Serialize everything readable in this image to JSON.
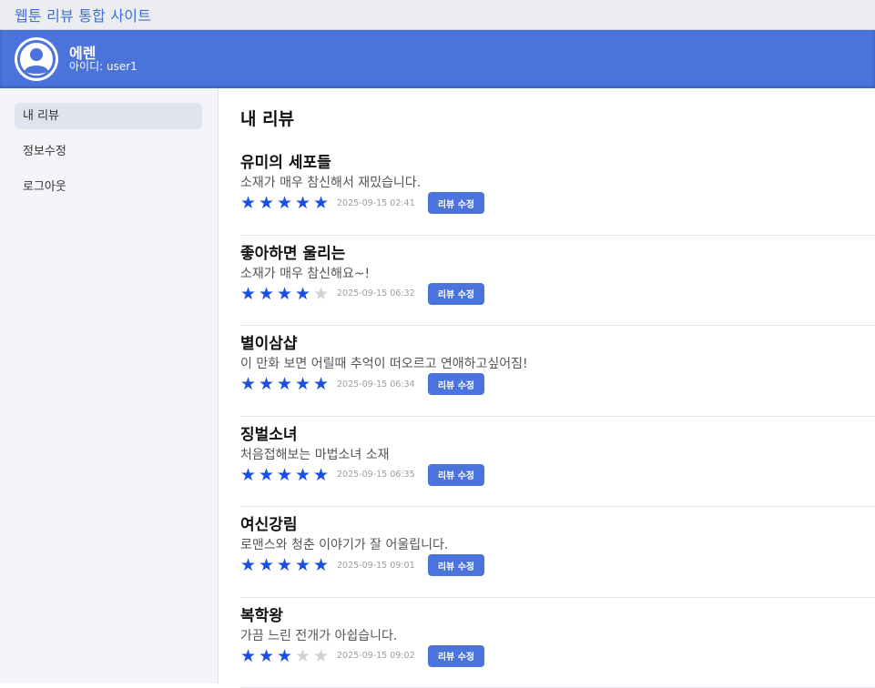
{
  "site": {
    "title": "웹툰 리뷰 통합 사이트"
  },
  "user": {
    "name": "에렌",
    "id_text": "아이디: user1"
  },
  "sidebar": {
    "items": [
      {
        "label": "내 리뷰",
        "active": true
      },
      {
        "label": "정보수정",
        "active": false
      },
      {
        "label": "로그아웃",
        "active": false
      }
    ]
  },
  "main": {
    "title": "내 리뷰",
    "reviews": [
      {
        "title": "유미의 세포들",
        "text": "소재가 매우 참신해서 재밌습니다.",
        "rating": 5,
        "date": "2025-09-15 02:41",
        "button": "리뷰 수정"
      },
      {
        "title": "좋아하면 울리는",
        "text": "소재가 매우 참신해요~!",
        "rating": 4,
        "date": "2025-09-15 06:32",
        "button": "리뷰 수정"
      },
      {
        "title": "별이삼샵",
        "text": "이 만화 보면 어릴때 추억이 떠오르고 연애하고싶어짐!",
        "rating": 5,
        "date": "2025-09-15 06:34",
        "button": "리뷰 수정"
      },
      {
        "title": "징벌소녀",
        "text": "처음접해보는 마법소녀 소재",
        "rating": 5,
        "date": "2025-09-15 06:35",
        "button": "리뷰 수정"
      },
      {
        "title": "여신강림",
        "text": "로맨스와 청춘 이야기가 잘 어울립니다.",
        "rating": 5,
        "date": "2025-09-15 09:01",
        "button": "리뷰 수정"
      },
      {
        "title": "복학왕",
        "text": "가끔 느린 전개가 아쉽습니다.",
        "rating": 3,
        "date": "2025-09-15 09:02",
        "button": "리뷰 수정"
      }
    ]
  },
  "colors": {
    "accent": "#4a74dc",
    "star_on": "#1a4fe6",
    "star_off": "#cfd2d8"
  },
  "icons": {
    "avatar": "user-avatar-icon",
    "star": "star-icon"
  }
}
